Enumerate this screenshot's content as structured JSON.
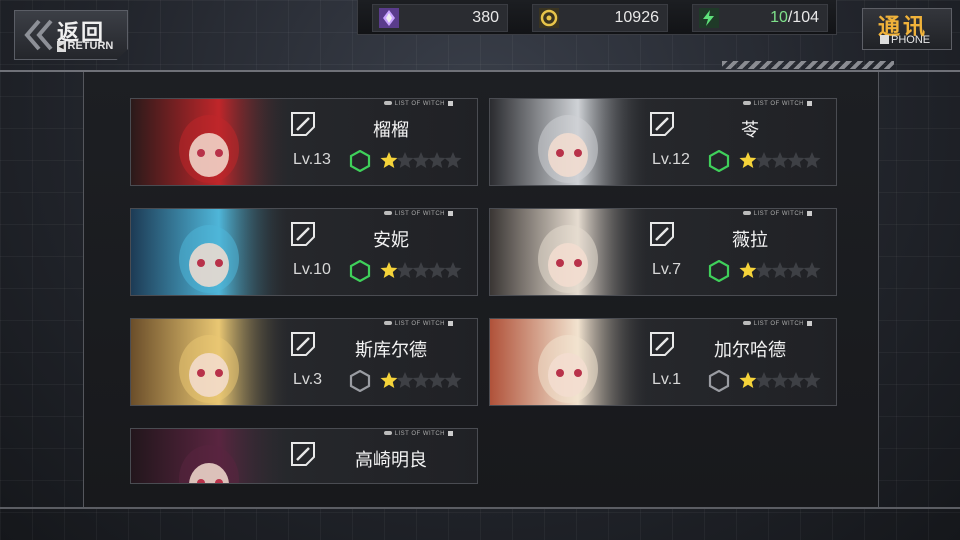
{
  "header": {
    "back": {
      "label_cn": "返回",
      "label_en": "RETURN"
    },
    "phone": {
      "label_cn": "通讯",
      "label_en": "PHONE"
    }
  },
  "resources": [
    {
      "icon": "crystal-icon",
      "value": "380",
      "color": "#b48cff"
    },
    {
      "icon": "coin-icon",
      "value": "10926",
      "color": "#e8c54a"
    },
    {
      "icon": "energy-icon",
      "value_current": "10",
      "value_max": "/104",
      "color": "#5ee07a"
    }
  ],
  "list_tag": "LIST OF WITCH",
  "witches": [
    {
      "name": "榴榴",
      "level": "Lv.13",
      "stars": 1,
      "max_stars": 5,
      "hex_active": true,
      "portrait_colors": [
        "#c0262a",
        "#2a1a1a"
      ]
    },
    {
      "name": "苓",
      "level": "Lv.12",
      "stars": 1,
      "max_stars": 5,
      "hex_active": true,
      "portrait_colors": [
        "#cfd2d6",
        "#2b2c30"
      ]
    },
    {
      "name": "安妮",
      "level": "Lv.10",
      "stars": 1,
      "max_stars": 5,
      "hex_active": true,
      "portrait_colors": [
        "#4fb6d9",
        "#1d3b55"
      ]
    },
    {
      "name": "薇拉",
      "level": "Lv.7",
      "stars": 1,
      "max_stars": 5,
      "hex_active": true,
      "portrait_colors": [
        "#e6dcd0",
        "#3a3634"
      ]
    },
    {
      "name": "斯库尔德",
      "level": "Lv.3",
      "stars": 1,
      "max_stars": 5,
      "hex_active": false,
      "portrait_colors": [
        "#e9c773",
        "#6b4e2a"
      ]
    },
    {
      "name": "加尔哈德",
      "level": "Lv.1",
      "stars": 1,
      "max_stars": 5,
      "hex_active": false,
      "portrait_colors": [
        "#f2e3cf",
        "#b0523a"
      ]
    },
    {
      "name": "高崎明良",
      "level": "",
      "stars": 0,
      "max_stars": 0,
      "hex_active": false,
      "portrait_colors": [
        "#5a2540",
        "#22161c"
      ]
    }
  ]
}
